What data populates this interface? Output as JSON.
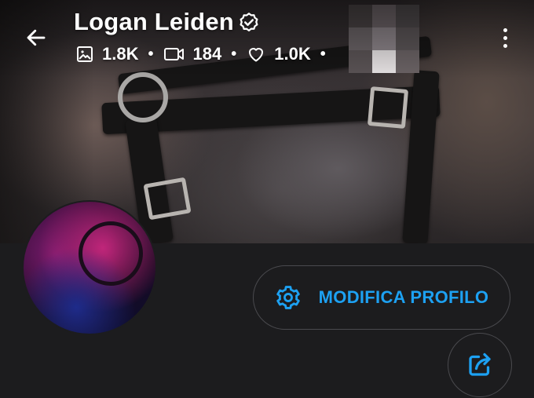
{
  "header": {
    "title": "Logan Leiden",
    "verified": true,
    "back_icon": "arrow-left-icon",
    "menu_icon": "kebab-menu-icon"
  },
  "stats": [
    {
      "icon": "image-icon",
      "value": "1.8K"
    },
    {
      "icon": "video-camera-icon",
      "value": "184"
    },
    {
      "icon": "heart-icon",
      "value": "1.0K"
    }
  ],
  "stats_separator": "•",
  "actions": {
    "edit_profile_label": "MODIFICA PROFILO",
    "edit_profile_icon": "gear-icon",
    "share_icon": "share-icon"
  },
  "colors": {
    "background": "#1c1c1e",
    "accent": "#1da1f2",
    "button_border": "#4a4a4e",
    "text": "#ffffff"
  }
}
